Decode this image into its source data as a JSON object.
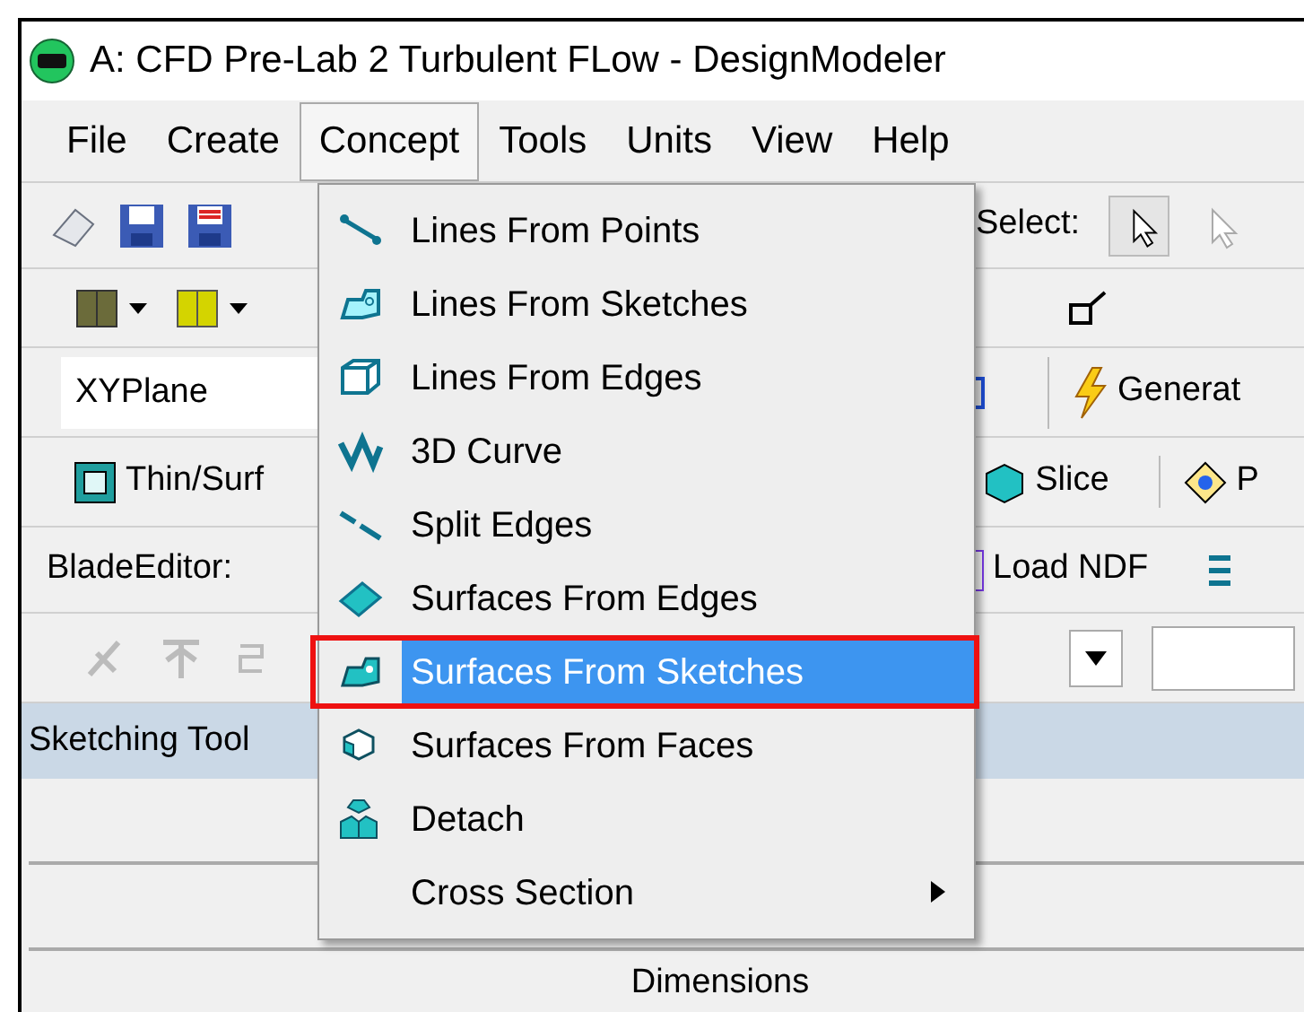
{
  "window": {
    "title": "A: CFD Pre-Lab 2 Turbulent FLow - DesignModeler"
  },
  "menu_bar": [
    {
      "label": "File",
      "selected": false
    },
    {
      "label": "Create",
      "selected": false
    },
    {
      "label": "Concept",
      "selected": true
    },
    {
      "label": "Tools",
      "selected": false
    },
    {
      "label": "Units",
      "selected": false
    },
    {
      "label": "View",
      "selected": false
    },
    {
      "label": "Help",
      "selected": false
    }
  ],
  "toolbar": {
    "select_label": "Select:",
    "plane_field": "XYPlane",
    "generate": "Generat",
    "thin_surface": "Thin/Surf",
    "slice": "Slice",
    "cut_button": "P",
    "blade_editor": "BladeEditor:",
    "load_ndf": "Load NDF"
  },
  "panel": {
    "title": "Sketching Tool",
    "section": "Dimensions"
  },
  "concept_menu": [
    {
      "label": "Lines From Points",
      "selected": false,
      "outlined": false,
      "submenu": false
    },
    {
      "label": "Lines From Sketches",
      "selected": false,
      "outlined": false,
      "submenu": false
    },
    {
      "label": "Lines From Edges",
      "selected": false,
      "outlined": false,
      "submenu": false
    },
    {
      "label": "3D Curve",
      "selected": false,
      "outlined": false,
      "submenu": false
    },
    {
      "label": "Split Edges",
      "selected": false,
      "outlined": false,
      "submenu": false
    },
    {
      "label": "Surfaces From Edges",
      "selected": false,
      "outlined": false,
      "submenu": false
    },
    {
      "label": "Surfaces From Sketches",
      "selected": true,
      "outlined": true,
      "submenu": false
    },
    {
      "label": "Surfaces From Faces",
      "selected": false,
      "outlined": false,
      "submenu": false
    },
    {
      "label": "Detach",
      "selected": false,
      "outlined": false,
      "submenu": false
    },
    {
      "label": "Cross Section",
      "selected": false,
      "outlined": false,
      "submenu": true
    }
  ]
}
